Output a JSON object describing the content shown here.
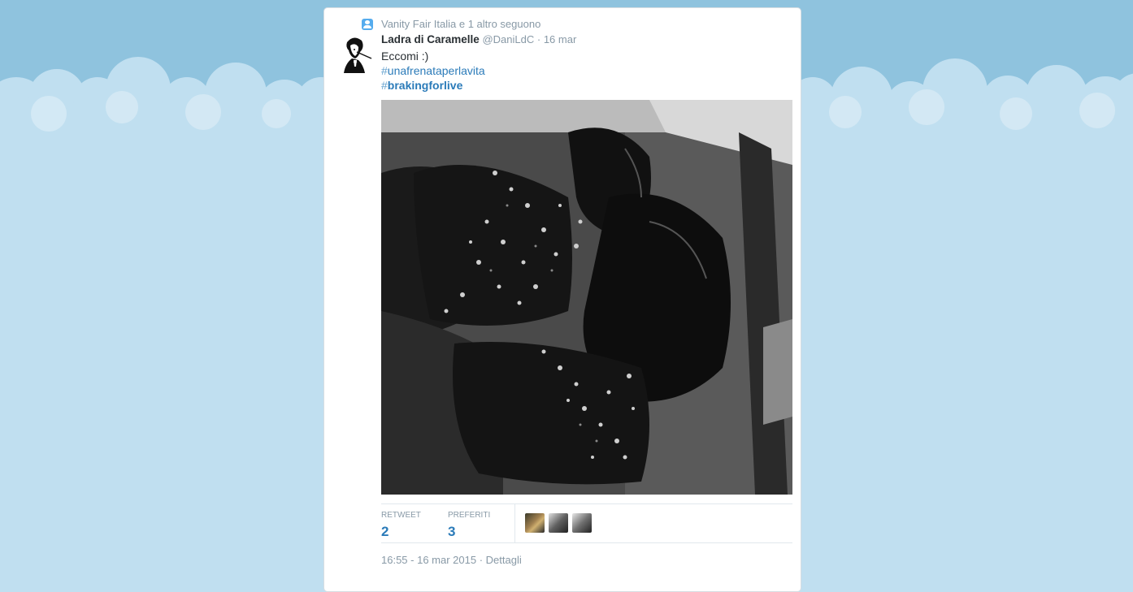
{
  "tweet": {
    "context": "Vanity Fair Italia e 1 altro seguono",
    "author_name": "Ladra di Caramelle",
    "author_handle": "@DaniLdC",
    "separator": "·",
    "date": "16 mar",
    "text": "Eccomi :)",
    "hashtags": [
      {
        "hash": "#",
        "tag": "unafrenataperlavita"
      },
      {
        "hash": "#",
        "tag": "brakingforlive"
      }
    ]
  },
  "stats": {
    "retweets": {
      "label": "RETWEET",
      "value": "2"
    },
    "favorites": {
      "label": "PREFERITI",
      "value": "3"
    }
  },
  "meta": {
    "timestamp": "16:55 - 16 mar 2015",
    "separator": "·",
    "details_link": "Dettagli"
  },
  "colors": {
    "link": "#2b7bb9",
    "sky": "#8fc3de",
    "sky_light": "#c0dff0"
  }
}
